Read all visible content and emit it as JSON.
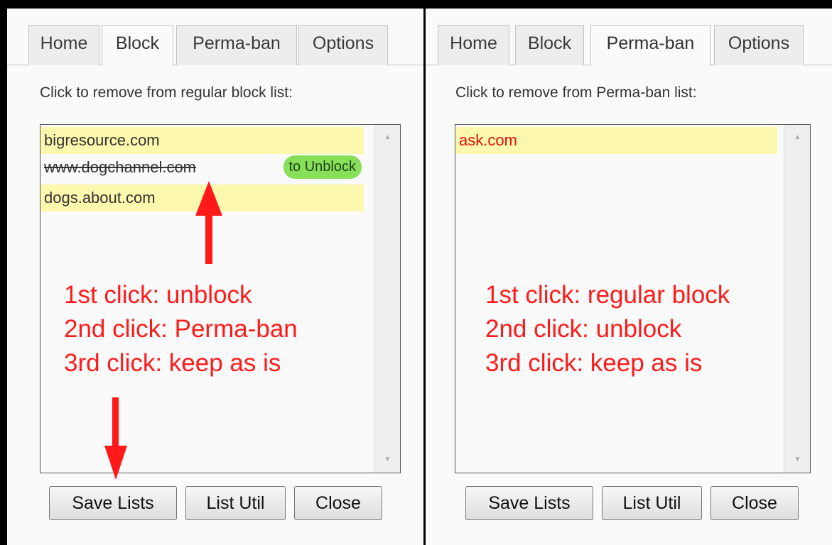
{
  "tabs": [
    "Home",
    "Block",
    "Perma-ban",
    "Options"
  ],
  "left_panel": {
    "active_tab": "Block",
    "instruction": "Click to remove from regular block list:",
    "items": [
      {
        "text": "bigresource.com"
      },
      {
        "text": "www.dogchannel.com",
        "badge": "to Unblock"
      },
      {
        "text": "dogs.about.com"
      }
    ],
    "note_lines": [
      "1st click: unblock",
      "2nd click: Perma-ban",
      "3rd click: keep as is"
    ]
  },
  "right_panel": {
    "active_tab": "Perma-ban",
    "instruction": "Click to remove from Perma-ban list:",
    "items": [
      {
        "text": "ask.com"
      }
    ],
    "note_lines": [
      "1st click: regular block",
      "2nd click: unblock",
      "3rd click: keep as is"
    ]
  },
  "buttons": {
    "save": "Save Lists",
    "util": "List Util",
    "close": "Close"
  },
  "colors": {
    "annotation": "#ff1a1a",
    "highlight": "#fcf8ad",
    "badge": "#88e05a",
    "ban_text": "#e01010"
  }
}
